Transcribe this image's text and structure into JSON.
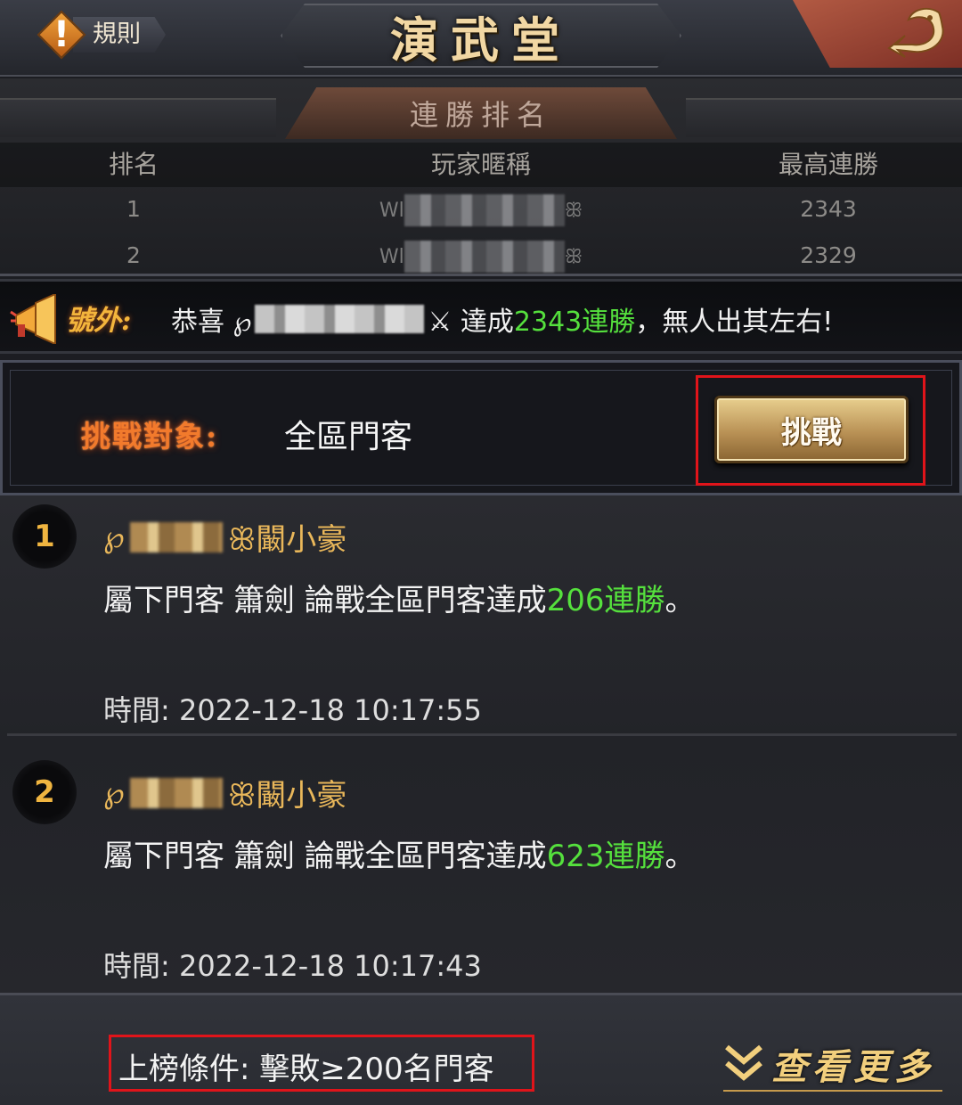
{
  "header": {
    "rules_icon": "exclamation-icon",
    "rules_label": "規則",
    "title": "演武堂",
    "back_icon": "dragon-back-icon"
  },
  "ranking": {
    "banner": "連勝排名",
    "columns": [
      "排名",
      "玩家暱稱",
      "最高連勝"
    ],
    "rows": [
      {
        "rank": "1",
        "name_prefix": "Wl",
        "name_suffix": "ꕥ",
        "best": "2343"
      },
      {
        "rank": "2",
        "name_prefix": "Wl",
        "name_suffix": "ꕥ",
        "best": "2329"
      }
    ]
  },
  "announcement": {
    "icon": "megaphone-icon",
    "label": "號外:",
    "text_before": "恭喜 ℘",
    "text_sword": "⚔ 達成",
    "highlight": "2343連勝",
    "text_after": "，無人出其左右!",
    "highlight_color": "#55e03d"
  },
  "challenge": {
    "label": "挑戰對象:",
    "target": "全區門客",
    "button_label": "挑戰"
  },
  "records": [
    {
      "number": "1",
      "name_prefix": "℘",
      "name_suffix": "ꕥ闞小豪",
      "desc_before": "屬下門客 簫劍 論戰全區門客達成",
      "desc_highlight": "206連勝",
      "desc_after": "。",
      "time_label": "時間:",
      "time_value": "2022-12-18 10:17:55"
    },
    {
      "number": "2",
      "name_prefix": "℘",
      "name_suffix": "ꕥ闞小豪",
      "desc_before": "屬下門客 簫劍 論戰全區門客達成",
      "desc_highlight": "623連勝",
      "desc_after": "。",
      "time_label": "時間:",
      "time_value": "2022-12-18 10:17:43"
    }
  ],
  "footer": {
    "condition": "上榜條件: 擊敗≥200名門客",
    "more_icon": "double-chevron-down-icon",
    "more_label": "查看更多"
  },
  "colors": {
    "accent_gold": "#e9b75a",
    "highlight_green": "#55e03d",
    "annotation_red": "#e0141a"
  }
}
